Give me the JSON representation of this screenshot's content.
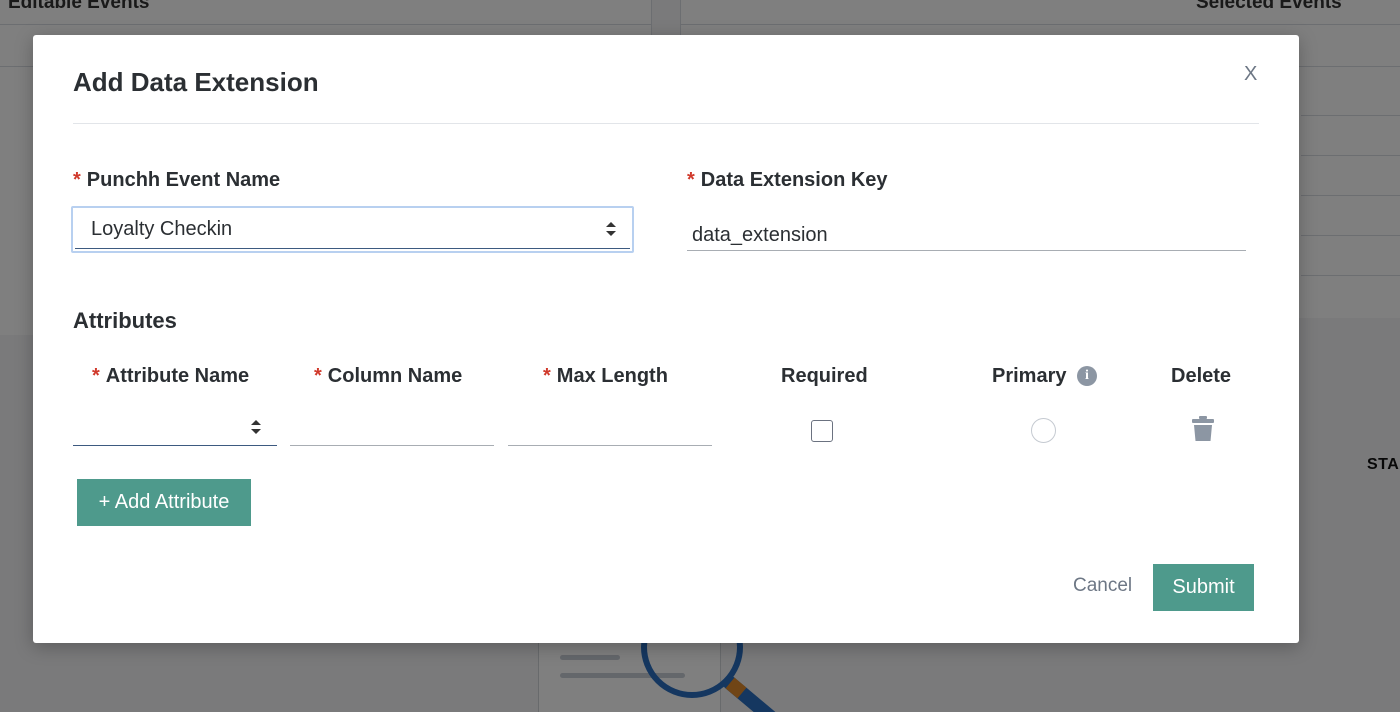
{
  "background": {
    "left_heading": "Editable Events",
    "right_heading": "Selected Events",
    "side_text": "STA"
  },
  "modal": {
    "title": "Add Data Extension",
    "close_label": "X",
    "event_name": {
      "label": "Punchh Event Name",
      "required_mark": "*",
      "selected_value": "Loyalty Checkin"
    },
    "extension_key": {
      "label": "Data Extension Key",
      "required_mark": "*",
      "value": "data_extension"
    },
    "attributes": {
      "section_title": "Attributes",
      "columns": {
        "attribute_name": "Attribute Name",
        "column_name": "Column Name",
        "max_length": "Max Length",
        "required": "Required",
        "primary": "Primary",
        "delete": "Delete"
      },
      "required_mark": "*",
      "row": {
        "attribute_name": "",
        "column_name": "",
        "max_length": "",
        "required_checked": false,
        "primary_selected": false
      },
      "add_button_label": "+ Add Attribute"
    },
    "footer": {
      "cancel_label": "Cancel",
      "submit_label": "Submit"
    }
  },
  "icons": {
    "info": "info-icon",
    "trash": "trash-icon",
    "sort": "sort-arrows-icon",
    "search": "magnifier-icon"
  },
  "colors": {
    "accent": "#4e9a8c",
    "required": "#d0392b",
    "overlay": "rgba(0,0,0,0.5)"
  }
}
